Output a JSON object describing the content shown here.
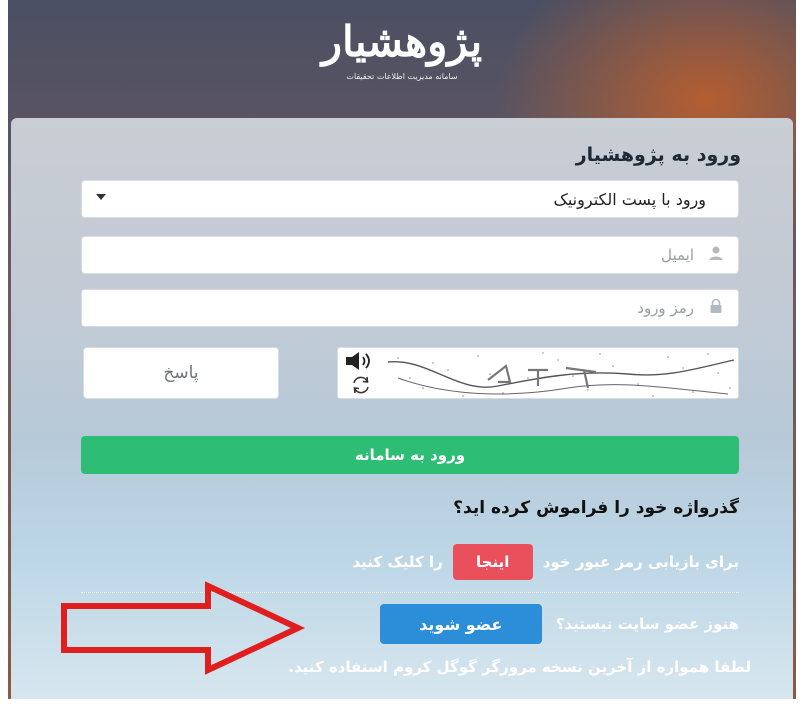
{
  "brand": {
    "logo_text": "پژوهشیار",
    "tagline": "سامانه مدیریت اطلاعات تحقیقات"
  },
  "login_panel": {
    "title": "ورود به پژوهشیار",
    "method_select": {
      "value": "ورود با پست الکترونیک"
    },
    "email": {
      "placeholder": "ایمیل",
      "value": "",
      "icon": "user-icon"
    },
    "password": {
      "placeholder": "رمز ورود",
      "value": "",
      "icon": "lock-icon"
    },
    "captcha": {
      "answer_placeholder": "پاسخ",
      "audio_icon": "speaker-icon",
      "refresh_icon": "refresh-icon"
    },
    "login_button": "ورود به سامانه"
  },
  "recovery": {
    "question": "گذرواژه خود را فراموش کرده اید؟",
    "prefix": "برای بازیابی رمز عبور خود",
    "link": "اینجا",
    "suffix": "را کلیک کنید"
  },
  "signup": {
    "prompt": "هنوز عضو سایت نیستید؟",
    "button": "عضو شوید"
  },
  "note": "لطفا همواره از آخرین نسخه مرورگر گوگل کروم استفاده کنید.",
  "colors": {
    "login_green": "#2dbd74",
    "here_red": "#e9505c",
    "signup_blue": "#2c8ed9",
    "annotation_red": "#e01e1e"
  }
}
